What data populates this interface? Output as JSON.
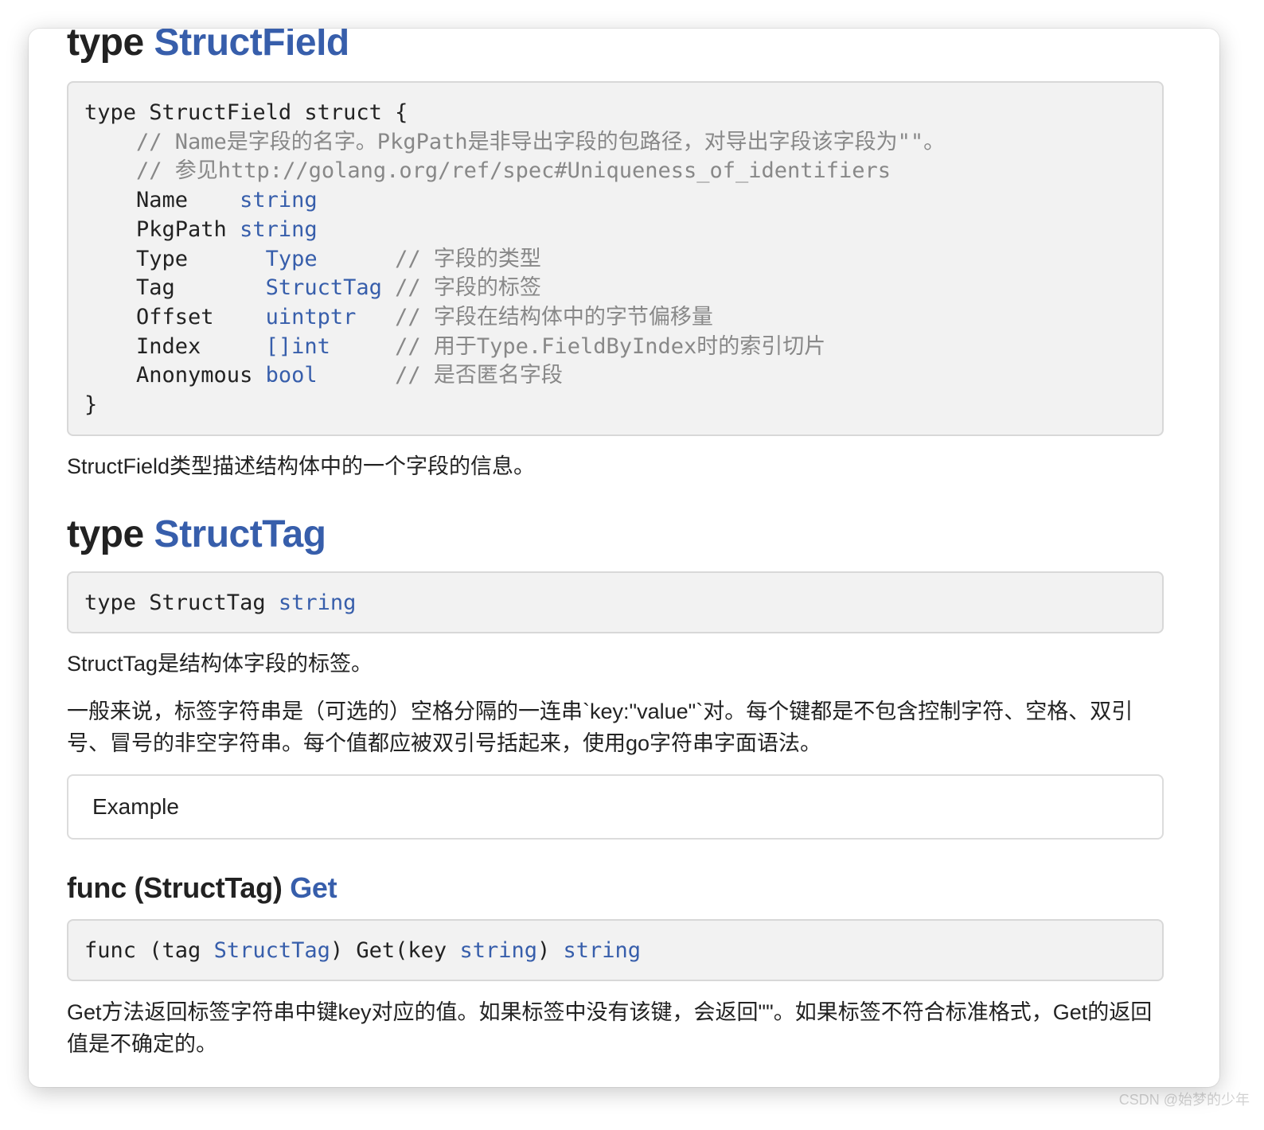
{
  "structfield": {
    "heading_prefix": "type",
    "heading_name": "StructField",
    "code": {
      "l1": "type StructField struct {",
      "c1": "    // Name是字段的名字。PkgPath是非导出字段的包路径，对导出字段该字段为\"\"。",
      "c2": "    // 参见http://golang.org/ref/spec#Uniqueness_of_identifiers",
      "f_name": "    Name    ",
      "f_name_t": "string",
      "f_pkg": "    PkgPath ",
      "f_pkg_t": "string",
      "f_type": "    Type      ",
      "f_type_t": "Type",
      "f_type_c": "      // 字段的类型",
      "f_tag": "    Tag       ",
      "f_tag_t": "StructTag",
      "f_tag_c": " // 字段的标签",
      "f_off": "    Offset    ",
      "f_off_t": "uintptr",
      "f_off_c": "   // 字段在结构体中的字节偏移量",
      "f_idx": "    Index     ",
      "f_idx_t": "[]int",
      "f_idx_c": "     // 用于Type.FieldByIndex时的索引切片",
      "f_anon": "    Anonymous ",
      "f_anon_t": "bool",
      "f_anon_c": "      // 是否匿名字段",
      "close": "}"
    },
    "desc": "StructField类型描述结构体中的一个字段的信息。"
  },
  "structtag": {
    "heading_prefix": "type",
    "heading_name": "StructTag",
    "code_prefix": "type StructTag ",
    "code_type": "string",
    "desc1": "StructTag是结构体字段的标签。",
    "desc2": "一般来说，标签字符串是（可选的）空格分隔的一连串`key:\"value\"`对。每个键都是不包含控制字符、空格、双引号、冒号的非空字符串。每个值都应被双引号括起来，使用go字符串字面语法。",
    "example_label": "Example"
  },
  "get": {
    "heading_prefix": "func (StructTag)",
    "heading_name": "Get",
    "code_a": "func (tag ",
    "code_b": "StructTag",
    "code_c": ") Get(key ",
    "code_d": "string",
    "code_e": ") ",
    "code_f": "string",
    "desc": "Get方法返回标签字符串中键key对应的值。如果标签中没有该键，会返回\"\"。如果标签不符合标准格式，Get的返回值是不确定的。"
  },
  "watermark": "CSDN @始梦的少年",
  "colors": {
    "link": "#375eab",
    "code_bg": "#f2f2f2",
    "comment": "#888888"
  }
}
